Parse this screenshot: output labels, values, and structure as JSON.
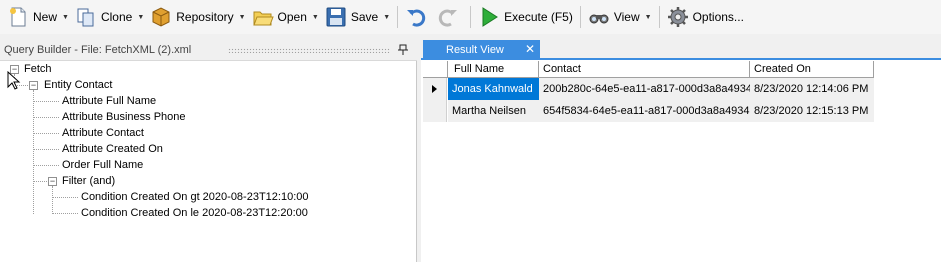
{
  "toolbar": {
    "new_label": "New",
    "clone_label": "Clone",
    "repository_label": "Repository",
    "open_label": "Open",
    "save_label": "Save",
    "execute_label": "Execute (F5)",
    "view_label": "View",
    "options_label": "Options..."
  },
  "left_pane": {
    "title": "Query Builder - File: FetchXML (2).xml",
    "tree": {
      "fetch": "Fetch",
      "entity": "Entity Contact",
      "attr_fullname": "Attribute Full Name",
      "attr_phone": "Attribute Business Phone",
      "attr_contact": "Attribute Contact",
      "attr_created": "Attribute Created On",
      "order": "Order Full Name",
      "filter": "Filter (and)",
      "cond1": "Condition Created On gt 2020-08-23T12:10:00",
      "cond2": "Condition Created On le 2020-08-23T12:20:00"
    }
  },
  "right_pane": {
    "tab_label": "Result View",
    "columns": [
      "Full Name",
      "Contact",
      "Created On"
    ],
    "rows": [
      [
        "Jonas Kahnwald",
        "200b280c-64e5-ea11-a817-000d3a8a4934",
        "8/23/2020 12:14:06 PM"
      ],
      [
        "Martha Neilsen",
        "654f5834-64e5-ea11-a817-000d3a8a4934",
        "8/23/2020 12:15:13 PM"
      ]
    ]
  }
}
